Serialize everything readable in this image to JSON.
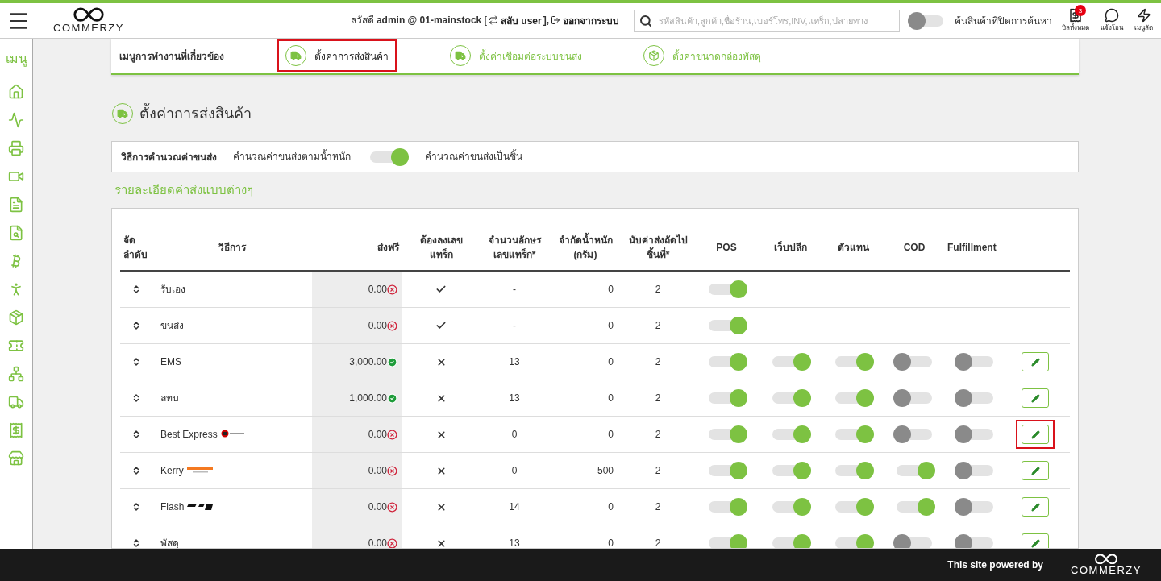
{
  "header": {
    "brand": "COMMERZY",
    "greeting": "สวัสดี **admin @ 01-mainstock** [",
    "switch_user": "สลับ user",
    "bracket_close": "],",
    "logout": "ออกจากระบบ",
    "search": {
      "placeholder": "รหัสสินค้า,ลูกค้า,ชื่อร้าน,เบอร์โทร,INV,แทร็ก,ปลายทาง"
    },
    "hidden_search": {
      "label": "ค้นสินค้าที่ปิดการค้นหา",
      "on": false
    },
    "shortcuts": [
      {
        "kind": "bill",
        "label": "บิลทั้งหมด",
        "badge": "3"
      },
      {
        "kind": "transfer",
        "label": "แจ้งโอน"
      },
      {
        "kind": "quick",
        "label": "เมนูลัด"
      }
    ]
  },
  "sidebar": {
    "title": "เมนู"
  },
  "related_menu": {
    "title": "เมนูการทำงานที่เกี่ยวข้อง",
    "items": [
      {
        "kind": "truck",
        "label": "ตั้งค่าการส่งสินค้า",
        "selected": true,
        "highlighted": true
      },
      {
        "kind": "truck",
        "label": "ตั้งค่าเชื่อมต่อระบบขนส่ง",
        "selected": false,
        "highlighted": false
      },
      {
        "kind": "box",
        "label": "ตั้งค่าขนาดกล่องพัสดุ",
        "selected": false,
        "highlighted": false
      }
    ]
  },
  "page_title": "ตั้งค่าการส่งสินค้า",
  "calc_method": {
    "label": "วิธีการคำนวณค่าขนส่ง",
    "by_weight": "คำนวณค่าขนส่งตามน้ำหนัก",
    "by_piece": "คำนวณค่าขนส่งเป็นชิ้น",
    "by_piece_on": true
  },
  "section_title": "รายละเอียดค่าส่งแบบต่างๆ",
  "table": {
    "columns": [
      "จัด\nลำดับ",
      "วิธีการ",
      "ส่งฟรี",
      "ต้องลงเลข\nแทร็ก",
      "จำนวนอักษร\nเลขแทร็ก*",
      "จำกัดน้ำหนัก\n(กรัม)",
      "นับค่าส่งถัดไป\nชิ้นที่*",
      "POS",
      "เว็บปลีก",
      "ตัวแทน",
      "COD",
      "Fulfillment"
    ],
    "rows": [
      {
        "method": "รับเอง",
        "free": "0.00",
        "free_on": false,
        "tracking": true,
        "chars": "-",
        "weight": "0",
        "next": "2",
        "channels": [
          true
        ],
        "editable": false
      },
      {
        "method": "ขนส่ง",
        "free": "0.00",
        "free_on": false,
        "tracking": true,
        "chars": "-",
        "weight": "0",
        "next": "2",
        "channels": [
          true
        ],
        "editable": false
      },
      {
        "method": "EMS",
        "free": "3,000.00",
        "free_on": true,
        "tracking": false,
        "chars": "13",
        "weight": "0",
        "next": "2",
        "channels": [
          true,
          true,
          true,
          false,
          false
        ],
        "editable": true,
        "highlighted": false
      },
      {
        "method": "ลทบ",
        "free": "1,000.00",
        "free_on": true,
        "tracking": false,
        "chars": "13",
        "weight": "0",
        "next": "2",
        "channels": [
          true,
          true,
          true,
          false,
          false
        ],
        "editable": true,
        "highlighted": false
      },
      {
        "method": "Best Express",
        "kind": "best",
        "free": "0.00",
        "free_on": false,
        "tracking": false,
        "chars": "0",
        "weight": "0",
        "next": "2",
        "channels": [
          true,
          true,
          true,
          false,
          false
        ],
        "editable": true,
        "highlighted": true
      },
      {
        "method": "Kerry",
        "kind": "kerry",
        "free": "0.00",
        "free_on": false,
        "tracking": false,
        "chars": "0",
        "weight": "500",
        "next": "2",
        "channels": [
          true,
          true,
          true,
          true,
          false
        ],
        "editable": true,
        "highlighted": false
      },
      {
        "method": "Flash",
        "kind": "flash",
        "free": "0.00",
        "free_on": false,
        "tracking": false,
        "chars": "14",
        "weight": "0",
        "next": "2",
        "channels": [
          true,
          true,
          true,
          true,
          false
        ],
        "editable": true,
        "highlighted": false
      },
      {
        "method": "พัสดุ",
        "free": "0.00",
        "free_on": false,
        "tracking": false,
        "chars": "13",
        "weight": "0",
        "next": "2",
        "channels": [
          true,
          true,
          true,
          false,
          false
        ],
        "editable": true,
        "highlighted": false
      }
    ]
  },
  "footer": {
    "powered_by": "This site powered by",
    "brand": "COMMERZY"
  }
}
